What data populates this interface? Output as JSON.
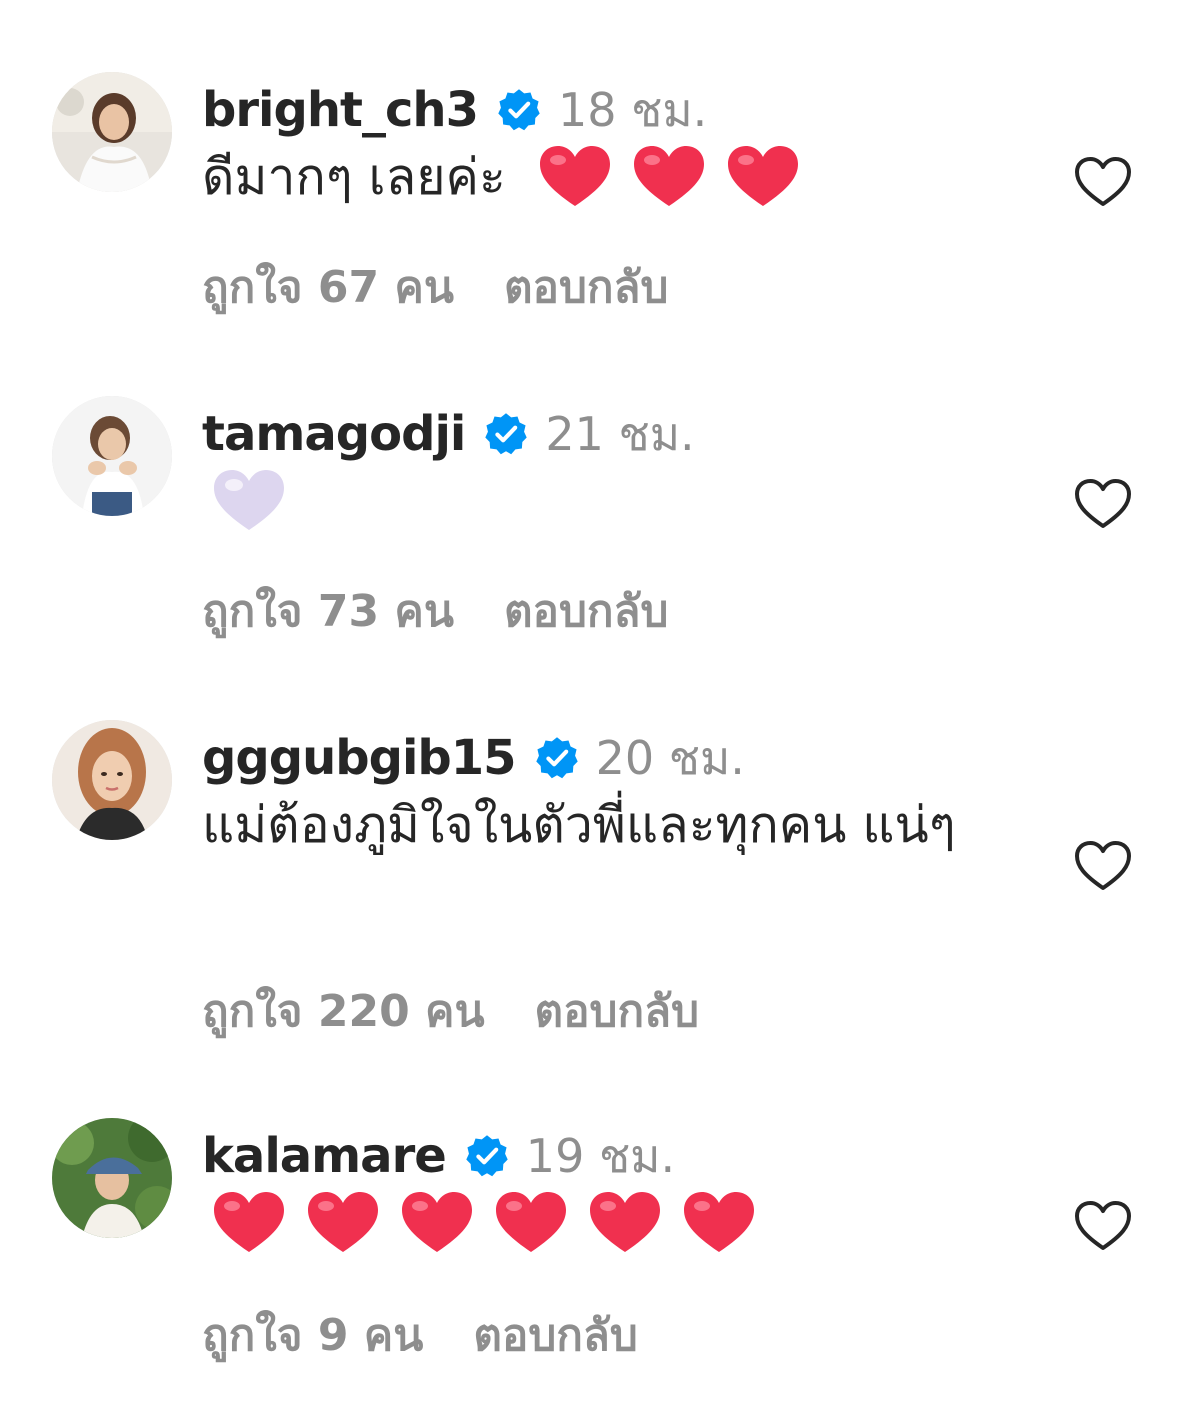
{
  "comments": [
    {
      "username": "bright_ch3",
      "time": "18 ชม.",
      "text": "ดีมากๆ เลยค่ะ",
      "emoji_count": 3,
      "emoji_color": "#f0304f",
      "likes": "ถูกใจ 67 คน",
      "reply": "ตอบกลับ"
    },
    {
      "username": "tamagodji",
      "time": "21 ชม.",
      "text": "",
      "emoji_count": 1,
      "emoji_color": "#d9d2ee",
      "likes": "ถูกใจ 73 คน",
      "reply": "ตอบกลับ"
    },
    {
      "username": "gggubgib15",
      "time": "20 ชม.",
      "text": "แม่ต้องภูมิใจในตัวพี่และทุกคน แน่ๆ",
      "emoji_count": 0,
      "likes": "ถูกใจ 220 คน",
      "reply": "ตอบกลับ"
    },
    {
      "username": "kalamare",
      "time": "19 ชม.",
      "text": "",
      "emoji_count": 6,
      "emoji_color": "#f0304f",
      "likes": "ถูกใจ 9 คน",
      "reply": "ตอบกลับ"
    }
  ],
  "colors": {
    "verified": "#0095f6",
    "muted": "#8e8e8e",
    "text": "#262626"
  },
  "icons": {
    "verified": "verified-badge-icon",
    "like": "heart-outline-icon",
    "emoji": "heart-emoji-icon"
  }
}
